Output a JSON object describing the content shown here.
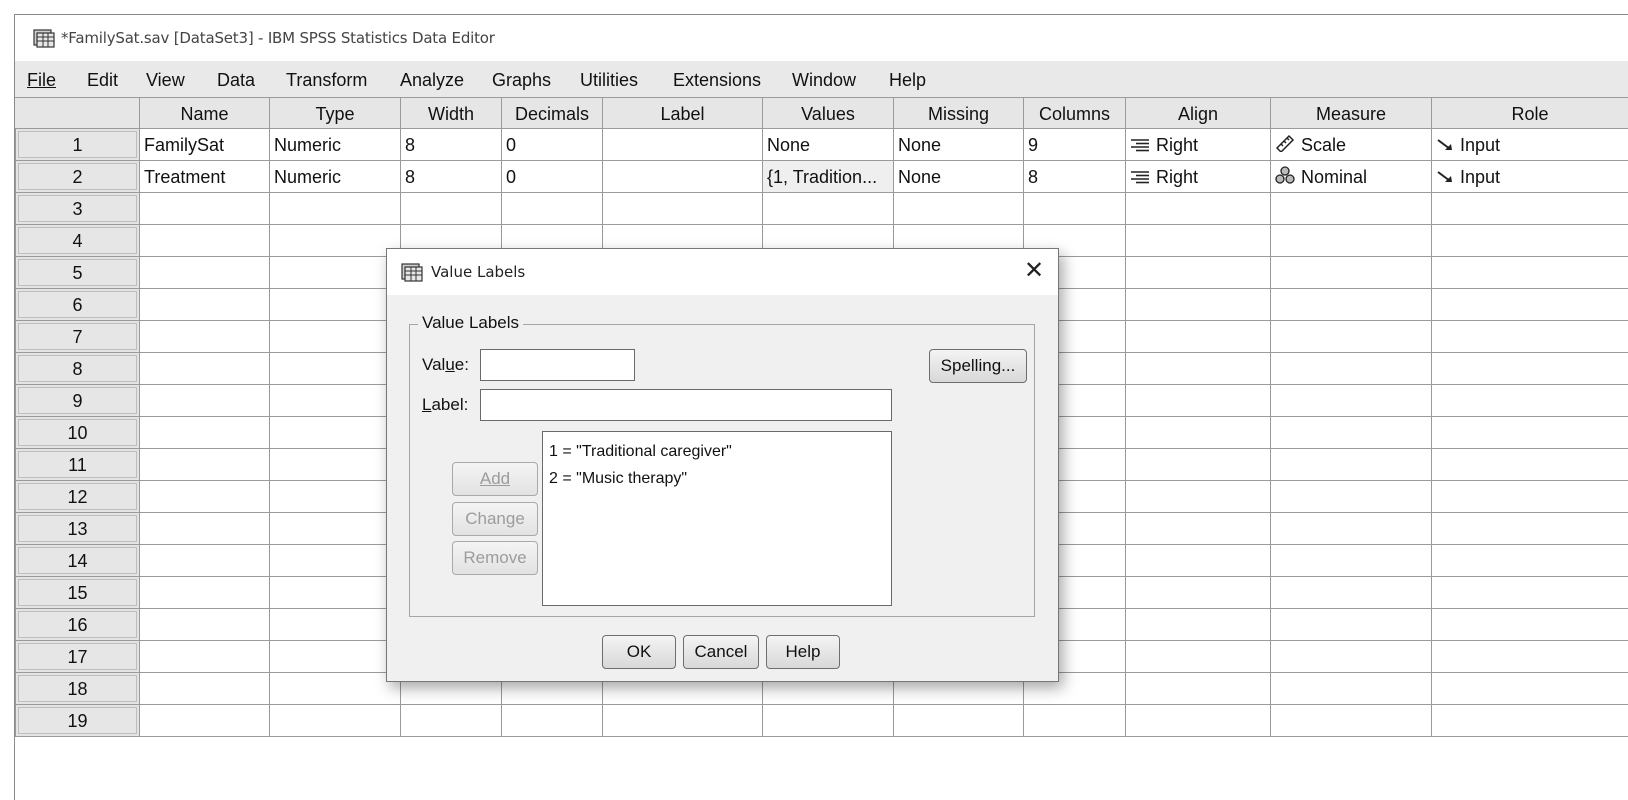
{
  "window": {
    "title": "*FamilySat.sav [DataSet3] - IBM SPSS Statistics Data Editor"
  },
  "menu": [
    "File",
    "Edit",
    "View",
    "Data",
    "Transform",
    "Analyze",
    "Graphs",
    "Utilities",
    "Extensions",
    "Window",
    "Help"
  ],
  "grid": {
    "headers": [
      "Name",
      "Type",
      "Width",
      "Decimals",
      "Label",
      "Values",
      "Missing",
      "Columns",
      "Align",
      "Measure",
      "Role"
    ],
    "rows": [
      {
        "num": "1",
        "name": "FamilySat",
        "type": "Numeric",
        "width": "8",
        "decimals": "0",
        "label": "",
        "values": "None",
        "missing": "None",
        "columns": "9",
        "align": "Right",
        "measure": "Scale",
        "role": "Input"
      },
      {
        "num": "2",
        "name": "Treatment",
        "type": "Numeric",
        "width": "8",
        "decimals": "0",
        "label": "",
        "values": "{1, Tradition...",
        "missing": "None",
        "columns": "8",
        "align": "Right",
        "measure": "Nominal",
        "role": "Input"
      }
    ],
    "empty_row_numbers": [
      "3",
      "4",
      "5",
      "6",
      "7",
      "8",
      "9",
      "10",
      "11",
      "12",
      "13",
      "14",
      "15",
      "16",
      "17",
      "18",
      "19"
    ]
  },
  "dialog": {
    "title": "Value Labels",
    "close_glyph": "✕",
    "group_label": "Value Labels",
    "value_label": "Value:",
    "label_label": "Label:",
    "value_input": "",
    "label_input": "",
    "spelling_button": "Spelling...",
    "add_button": "Add",
    "change_button": "Change",
    "remove_button": "Remove",
    "list_items": [
      "1 = \"Traditional caregiver\"",
      "2 = \"Music therapy\""
    ],
    "ok_button": "OK",
    "cancel_button": "Cancel",
    "help_button": "Help"
  },
  "icons": {
    "app": "spss-data-editor-icon",
    "align": "align-right-icon",
    "scale": "ruler-scale-icon",
    "nominal": "nominal-circles-icon",
    "role": "input-arrow-icon"
  }
}
